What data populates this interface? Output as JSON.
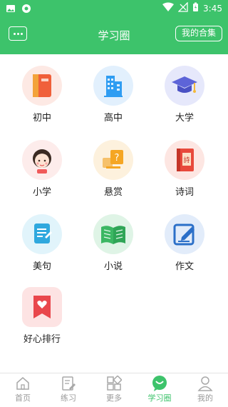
{
  "status_bar": {
    "time": "3:45"
  },
  "header": {
    "title": "学习圈",
    "collection_label": "我的合集"
  },
  "grid": {
    "items": [
      {
        "label": "初中",
        "icon": "book-icon"
      },
      {
        "label": "高中",
        "icon": "building-icon"
      },
      {
        "label": "大学",
        "icon": "graduation-cap-icon"
      },
      {
        "label": "小学",
        "icon": "girl-icon"
      },
      {
        "label": "悬赏",
        "icon": "question-card-icon"
      },
      {
        "label": "诗词",
        "icon": "poetry-book-icon"
      },
      {
        "label": "美句",
        "icon": "document-icon"
      },
      {
        "label": "小说",
        "icon": "open-book-icon"
      },
      {
        "label": "作文",
        "icon": "edit-icon"
      },
      {
        "label": "好心排行",
        "icon": "heart-bookmark-icon"
      }
    ]
  },
  "tabs": [
    {
      "label": "首页",
      "icon": "home-icon"
    },
    {
      "label": "练习",
      "icon": "practice-icon"
    },
    {
      "label": "更多",
      "icon": "grid-icon"
    },
    {
      "label": "学习圈",
      "icon": "chat-icon",
      "active": true
    },
    {
      "label": "我的",
      "icon": "user-icon"
    }
  ],
  "colors": {
    "brand": "#3dc36b"
  }
}
